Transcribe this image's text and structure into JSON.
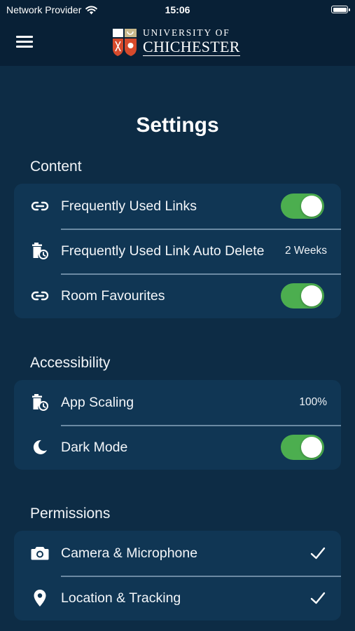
{
  "status_bar": {
    "carrier": "Network Provider",
    "time": "15:06"
  },
  "header": {
    "logo_line1": "UNIVERSITY OF",
    "logo_line2": "CHICHESTER"
  },
  "page": {
    "title": "Settings"
  },
  "sections": {
    "content": {
      "label": "Content",
      "items": [
        {
          "label": "Frequently Used Links",
          "icon": "link-icon",
          "toggle": true
        },
        {
          "label": "Frequently Used Link Auto Delete",
          "icon": "trash-clock-icon",
          "value": "2 Weeks"
        },
        {
          "label": "Room Favourites",
          "icon": "link-icon",
          "toggle": true
        }
      ]
    },
    "accessibility": {
      "label": "Accessibility",
      "items": [
        {
          "label": "App Scaling",
          "icon": "trash-clock-icon",
          "value": "100%"
        },
        {
          "label": "Dark Mode",
          "icon": "moon-icon",
          "toggle": true
        }
      ]
    },
    "permissions": {
      "label": "Permissions",
      "items": [
        {
          "label": "Camera & Microphone",
          "icon": "camera-icon",
          "checked": true
        },
        {
          "label": "Location & Tracking",
          "icon": "location-pin-icon",
          "checked": true
        }
      ]
    }
  },
  "colors": {
    "background": "#0d2c45",
    "header": "#082036",
    "card": "#103654",
    "toggle_on": "#4cae4f"
  }
}
